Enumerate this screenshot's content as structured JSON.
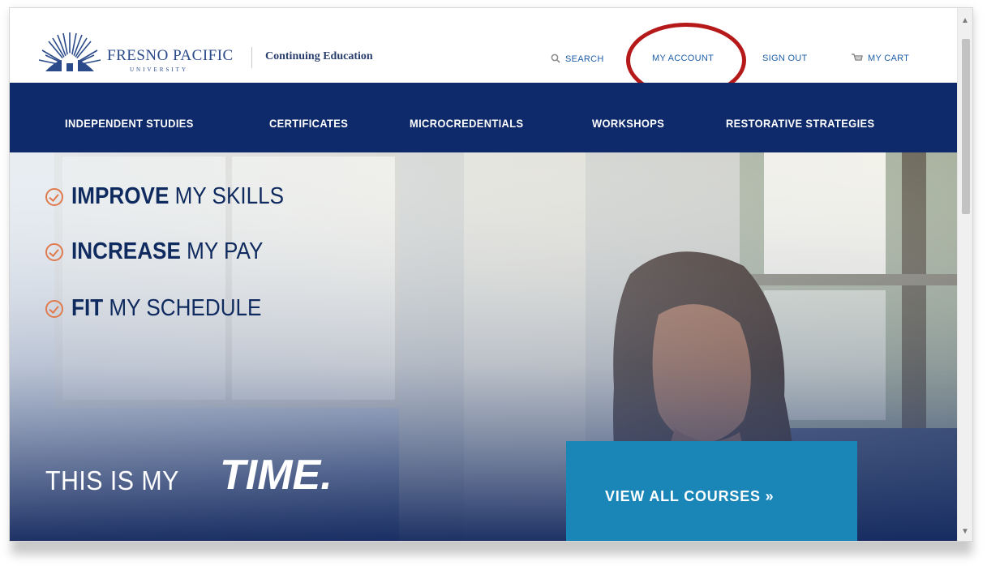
{
  "header": {
    "logo_name": "FRESNO PACIFIC",
    "logo_sub": "UNIVERSITY",
    "section_label": "Continuing Education",
    "search_label": "SEARCH",
    "account_label": "MY ACCOUNT",
    "signout_label": "SIGN OUT",
    "cart_label": "MY CART"
  },
  "nav": {
    "items": [
      {
        "label": "INDEPENDENT STUDIES"
      },
      {
        "label": "CERTIFICATES"
      },
      {
        "label": "MICROCREDENTIALS"
      },
      {
        "label": "WORKSHOPS"
      },
      {
        "label": "RESTORATIVE STRATEGIES"
      }
    ]
  },
  "hero": {
    "benefits": [
      {
        "bold": "IMPROVE",
        "rest": " MY SKILLS"
      },
      {
        "bold": "INCREASE",
        "rest": " MY PAY"
      },
      {
        "bold": "FIT",
        "rest": " MY SCHEDULE"
      }
    ],
    "tagline_small": "THIS IS MY",
    "tagline_big": "TIME.",
    "cta_label": "VIEW ALL COURSES  »"
  },
  "colors": {
    "nav_bg": "#0e2a6b",
    "cta_bg": "#1a86b8",
    "highlight": "#b51919",
    "check": "#e07a4f"
  }
}
